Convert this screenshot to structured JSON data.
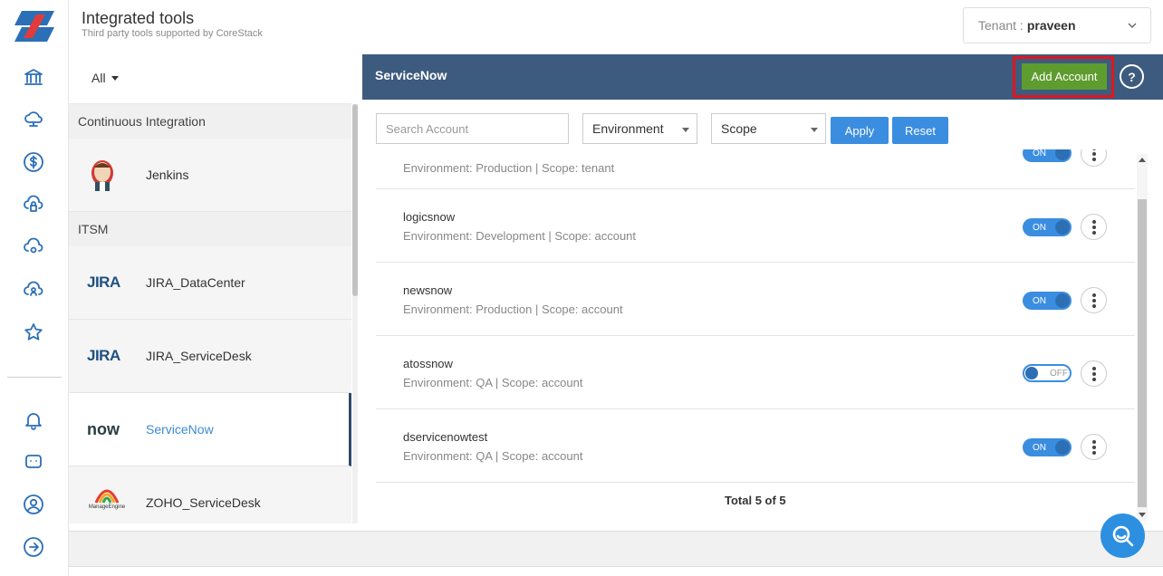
{
  "header": {
    "title": "Integrated tools",
    "subtitle": "Third party tools supported by CoreStack",
    "tenant_label": "Tenant :",
    "tenant_value": "praveen"
  },
  "rail": {
    "icons": [
      "bank-icon",
      "cloud-network-icon",
      "dollar-icon",
      "cloud-lock-icon",
      "cloud-gear-icon",
      "cloud-user-icon",
      "star-icon",
      "bell-icon",
      "chat-bot-icon",
      "user-icon",
      "logout-icon"
    ]
  },
  "tools": {
    "filter_label": "All",
    "sections": [
      {
        "name": "Continuous Integration",
        "items": [
          {
            "label": "Jenkins"
          }
        ]
      },
      {
        "name": "ITSM",
        "items": [
          {
            "label": "JIRA_DataCenter"
          },
          {
            "label": "JIRA_ServiceDesk"
          },
          {
            "label": "ServiceNow"
          },
          {
            "label": "ZOHO_ServiceDesk"
          }
        ]
      }
    ],
    "logo_text": {
      "jira": "JIRA",
      "now": "now",
      "manage_engine": "ManageEngine"
    }
  },
  "detail": {
    "title": "ServiceNow",
    "add_account_label": "Add Account",
    "help_label": "?",
    "search_placeholder": "Search Account",
    "environment_label": "Environment",
    "scope_label": "Scope",
    "apply_label": "Apply",
    "reset_label": "Reset",
    "accounts": [
      {
        "name": "",
        "meta": "Environment: Production | Scope: tenant",
        "toggle": "ON"
      },
      {
        "name": "logicsnow",
        "meta": "Environment: Development | Scope: account",
        "toggle": "ON"
      },
      {
        "name": "newsnow",
        "meta": "Environment: Production | Scope: account",
        "toggle": "ON"
      },
      {
        "name": "atossnow",
        "meta": "Environment: QA | Scope: account",
        "toggle": "OFF"
      },
      {
        "name": "dservicenowtest",
        "meta": "Environment: QA | Scope: account",
        "toggle": "ON"
      }
    ],
    "total_label": "Total 5 of 5"
  },
  "colors": {
    "panel_header": "#3d5b7e",
    "accent_blue": "#3b8de0",
    "add_green": "#5f9c2f",
    "highlight_red": "#e0161f"
  }
}
